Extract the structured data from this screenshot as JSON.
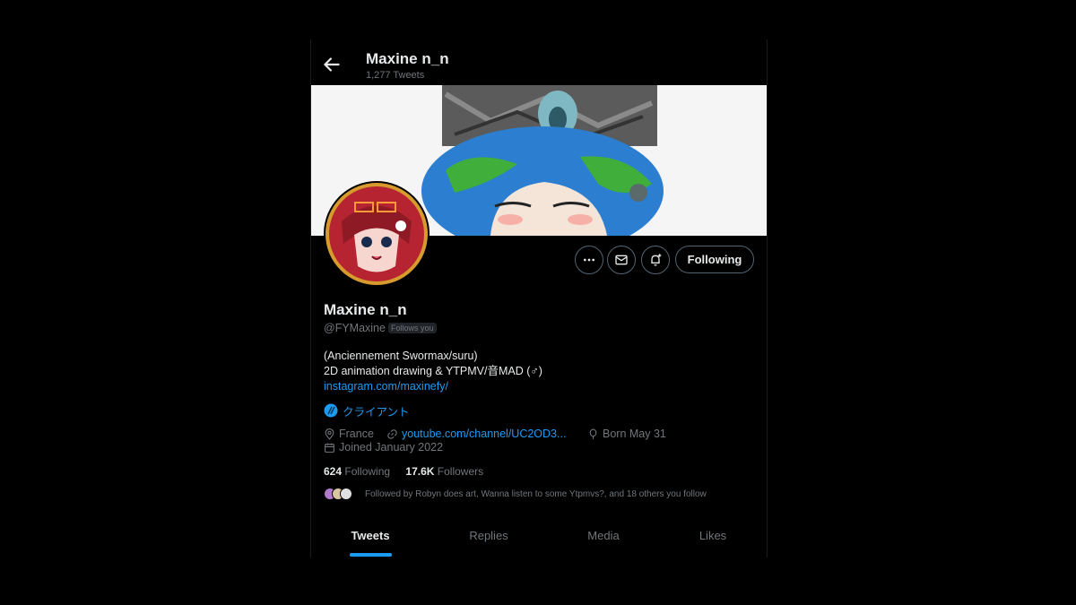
{
  "header": {
    "title": "Maxine n_n",
    "tweet_count": "1,277 Tweets"
  },
  "actions": {
    "follow_label": "Following",
    "more_icon": "more-icon",
    "message_icon": "mail-icon",
    "notify_icon": "bell-plus-icon"
  },
  "profile": {
    "name": "Maxine n_n",
    "handle": "@FYMaxine",
    "follows_you": "Follows you",
    "bio_line1": "(Anciennement Swormax/suru)",
    "bio_line2": "2D animation drawing & YTPMV/音MAD (♂)",
    "bio_link": "instagram.com/maxinefy/",
    "affiliate": "クライアント",
    "location": "France",
    "website": "youtube.com/channel/UC2OD3...",
    "birthday": "Born May 31",
    "joined": "Joined January 2022",
    "following_count": "624",
    "following_label": "Following",
    "followers_count": "17.6K",
    "followers_label": "Followers",
    "followed_by": "Followed by Robyn does art, Wanna listen to some Ytpmvs?, and 18 others you follow"
  },
  "tabs": [
    "Tweets",
    "Replies",
    "Media",
    "Likes"
  ],
  "colors": {
    "accent": "#1d9bf0",
    "background": "#000000",
    "muted": "#71767b"
  }
}
